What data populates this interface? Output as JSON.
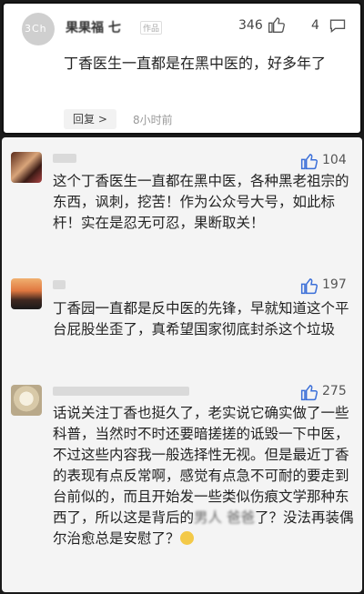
{
  "top_comment": {
    "avatar_text": "3Ch",
    "username": "果果福 七",
    "badge": "作品",
    "likes": "346",
    "replies": "4",
    "text": "丁香医生一直都是在黑中医的，好多年了",
    "reply_button": "回复 >",
    "time": "8小时前",
    "icons": {
      "like": "thumb-up-icon",
      "reply": "comment-bubble-icon"
    }
  },
  "replies": [
    {
      "likes": "104",
      "text": "这个丁香医生一直都在黑中医，各种黑老祖宗的东西，讽刺，挖苦！作为公众号大号，如此标杆！实在是忍无可忍，果断取关！"
    },
    {
      "likes": "197",
      "text": "丁香园一直都是反中医的先锋，早就知道这个平台屁股坐歪了，真希望国家彻底封杀这个垃圾"
    },
    {
      "likes": "275",
      "text_main": "话说关注丁香也挺久了，老实说它确实做了一些科普，当然时不时还要暗搓搓的诋毁一下中医，不过这些内容我一般选择性无视。但是最近丁香的表现有点反常啊，感觉有点急不可耐的要走到台前似的，而且开始发一些类似伤痕文学那种东西了，所以这是背后的",
      "text_blurred": "男人 爸爸",
      "text_end": "了？没法再装偶尔治愈总是安慰了？"
    }
  ],
  "colors": {
    "like_blue": "#3b6fd8",
    "page_bg": "#f4f4f4",
    "border": "#111111"
  }
}
